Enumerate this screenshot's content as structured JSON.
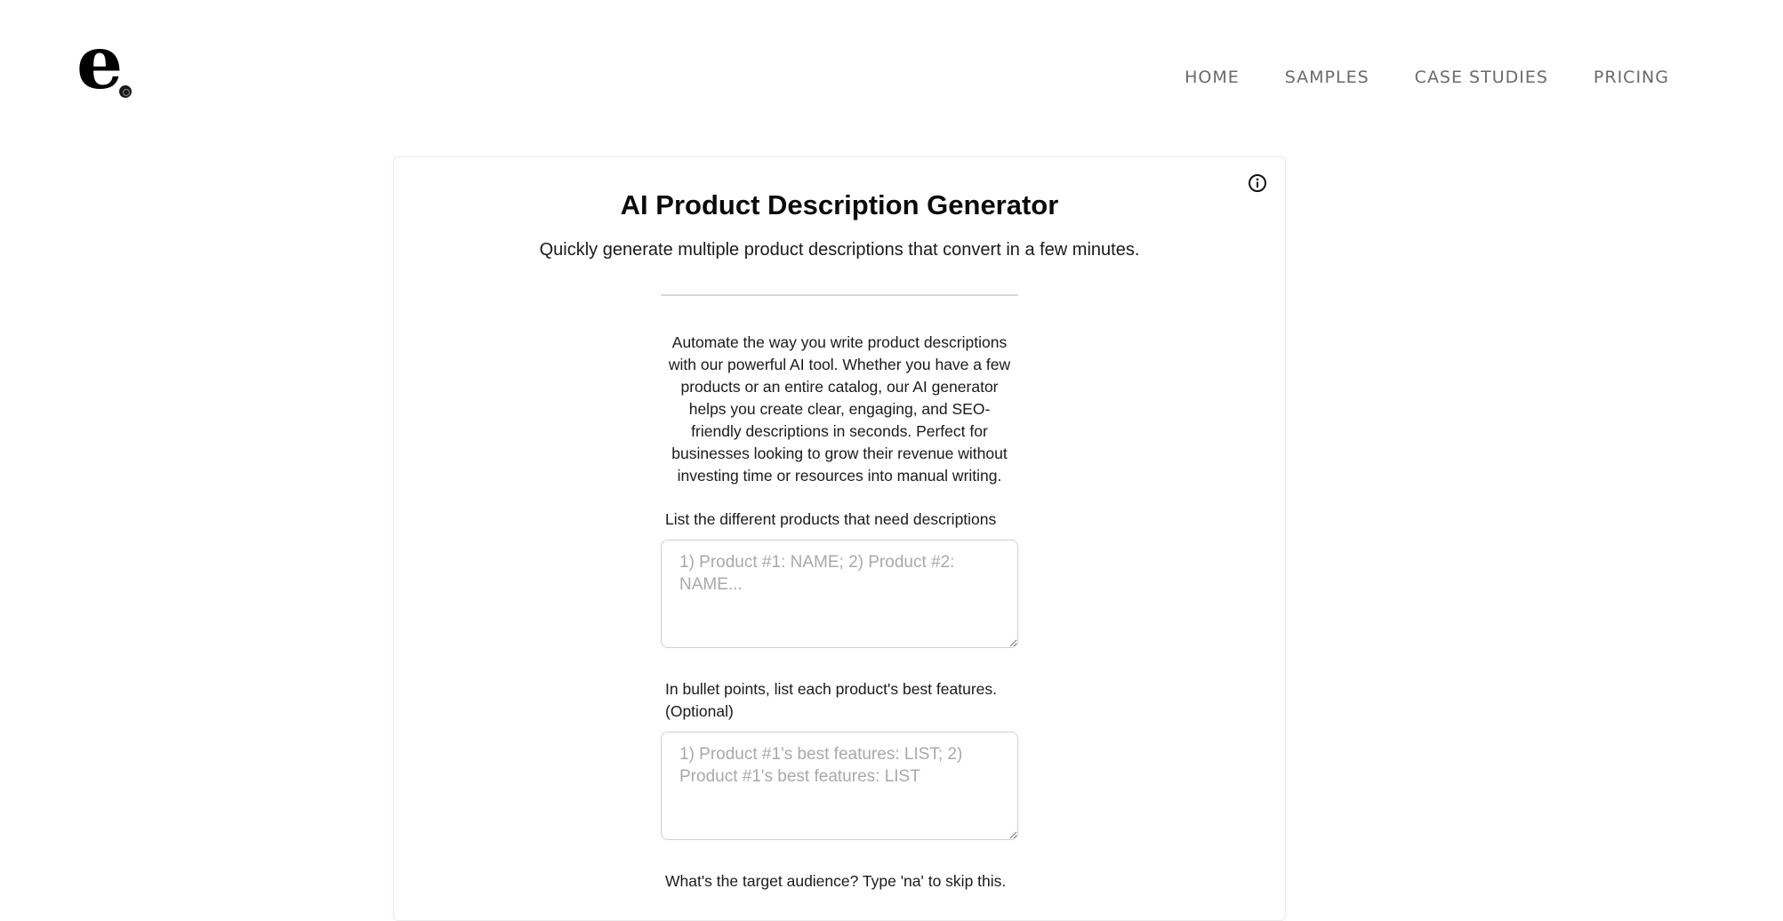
{
  "header": {
    "logo_text": "e",
    "nav": [
      {
        "label": "HOME"
      },
      {
        "label": "SAMPLES"
      },
      {
        "label": "CASE STUDIES"
      },
      {
        "label": "PRICING"
      }
    ]
  },
  "main": {
    "title": "AI Product Description Generator",
    "subtitle": "Quickly generate multiple product descriptions that convert in a few minutes.",
    "intro": "Automate the way you write product descriptions with our powerful AI tool. Whether you have a few products or an entire catalog, our AI generator helps you create clear, engaging, and SEO-friendly descriptions in seconds. Perfect for businesses looking to grow their revenue without investing time or resources into manual writing.",
    "fields": [
      {
        "label": "List the different products that need descriptions",
        "placeholder": "1) Product #1: NAME; 2) Product #2: NAME...",
        "value": ""
      },
      {
        "label": "In bullet points, list each product's best features. (Optional)",
        "placeholder": "1) Product #1's best features: LIST; 2) Product #1's best features: LIST",
        "value": ""
      },
      {
        "label": "What's the target audience? Type 'na' to skip this."
      }
    ]
  },
  "icons": {
    "info": "info-icon"
  }
}
